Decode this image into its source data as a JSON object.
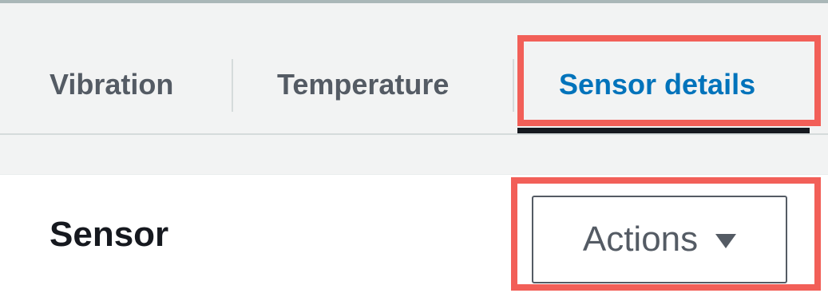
{
  "tabs": [
    {
      "label": "Vibration",
      "selected": false
    },
    {
      "label": "Temperature",
      "selected": false
    },
    {
      "label": "Sensor details",
      "selected": true
    }
  ],
  "section": {
    "heading": "Sensor",
    "actions_label": "Actions",
    "actions_icon": "caret-down-icon"
  },
  "colors": {
    "active_tab": "#0073bb",
    "inactive_tab": "#545b64",
    "highlight_box": "#f25f58",
    "tab_underline": "#16191f"
  }
}
